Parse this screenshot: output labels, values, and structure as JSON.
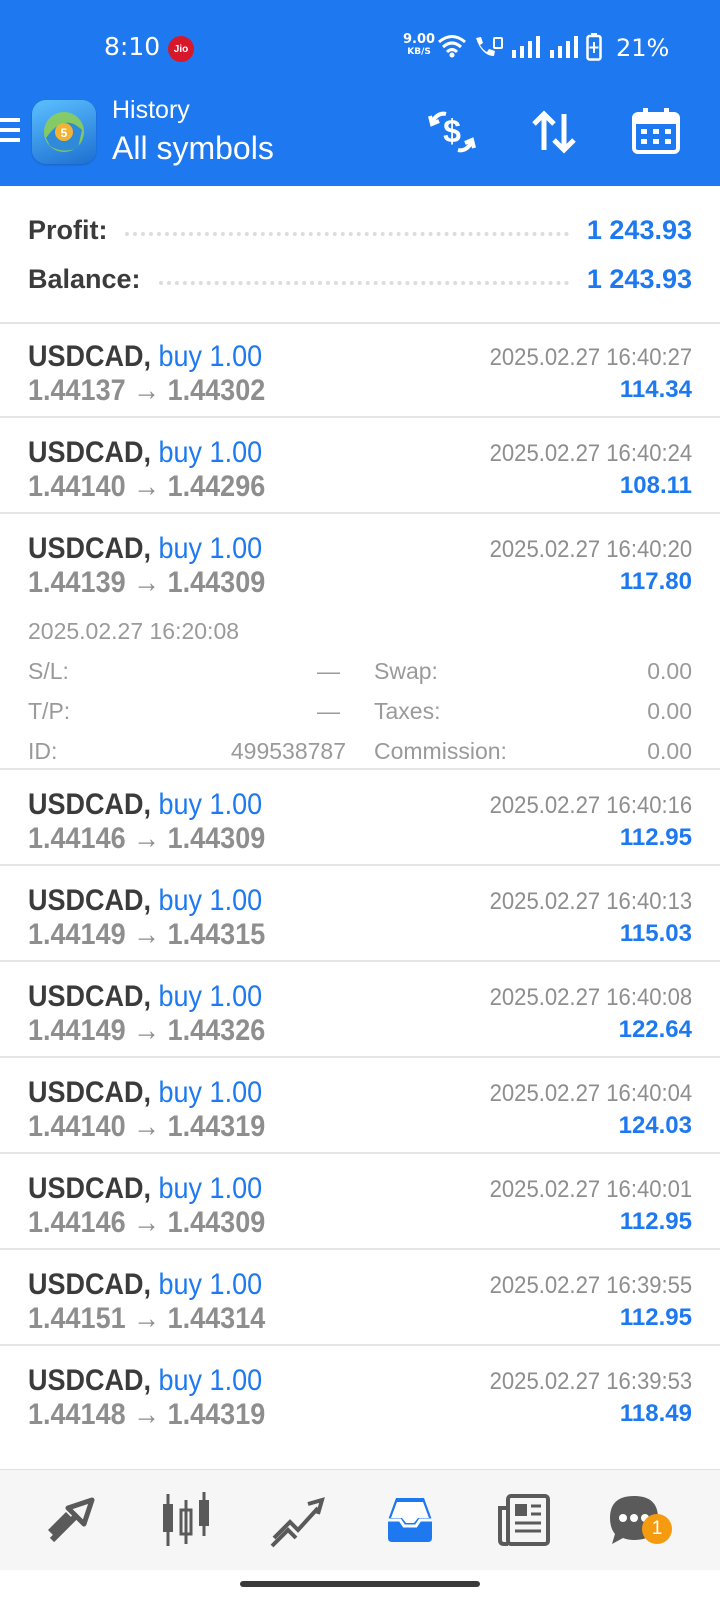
{
  "status_bar": {
    "time": "8:10",
    "carrier_badge": "Jio",
    "net_speed_value": "9.00",
    "net_speed_unit": "KB/S",
    "battery_percent": "21%"
  },
  "app_bar": {
    "title": "History",
    "subtitle": "All symbols",
    "icons": [
      "menu-icon",
      "metatrader-logo",
      "dollar-refresh-icon",
      "sort-icon",
      "calendar-icon"
    ]
  },
  "summary": {
    "profit_label": "Profit:",
    "profit_value": "1 243.93",
    "balance_label": "Balance:",
    "balance_value": "1 243.93"
  },
  "deals": [
    {
      "symbol": "USDCAD,",
      "type": "buy 1.00",
      "price_open": "1.44137",
      "price_close": "1.44302",
      "arrow": "→",
      "time": "2025.02.27 16:40:27",
      "profit": "114.34"
    },
    {
      "symbol": "USDCAD,",
      "type": "buy 1.00",
      "price_open": "1.44140",
      "price_close": "1.44296",
      "arrow": "→",
      "time": "2025.02.27 16:40:24",
      "profit": "108.11"
    },
    {
      "symbol": "USDCAD,",
      "type": "buy 1.00",
      "price_open": "1.44139",
      "price_close": "1.44309",
      "arrow": "→",
      "time": "2025.02.27 16:40:20",
      "profit": "117.80"
    },
    {
      "symbol": "USDCAD,",
      "type": "buy 1.00",
      "price_open": "1.44146",
      "price_close": "1.44309",
      "arrow": "→",
      "time": "2025.02.27 16:40:16",
      "profit": "112.95"
    },
    {
      "symbol": "USDCAD,",
      "type": "buy 1.00",
      "price_open": "1.44149",
      "price_close": "1.44315",
      "arrow": "→",
      "time": "2025.02.27 16:40:13",
      "profit": "115.03"
    },
    {
      "symbol": "USDCAD,",
      "type": "buy 1.00",
      "price_open": "1.44149",
      "price_close": "1.44326",
      "arrow": "→",
      "time": "2025.02.27 16:40:08",
      "profit": "122.64"
    },
    {
      "symbol": "USDCAD,",
      "type": "buy 1.00",
      "price_open": "1.44140",
      "price_close": "1.44319",
      "arrow": "→",
      "time": "2025.02.27 16:40:04",
      "profit": "124.03"
    },
    {
      "symbol": "USDCAD,",
      "type": "buy 1.00",
      "price_open": "1.44146",
      "price_close": "1.44309",
      "arrow": "→",
      "time": "2025.02.27 16:40:01",
      "profit": "112.95"
    },
    {
      "symbol": "USDCAD,",
      "type": "buy 1.00",
      "price_open": "1.44151",
      "price_close": "1.44314",
      "arrow": "→",
      "time": "2025.02.27 16:39:55",
      "profit": "112.95"
    },
    {
      "symbol": "USDCAD,",
      "type": "buy 1.00",
      "price_open": "1.44148",
      "price_close": "1.44319",
      "arrow": "→",
      "time": "2025.02.27 16:39:53",
      "profit": "118.49"
    }
  ],
  "expanded_details": {
    "open_time": "2025.02.27 16:20:08",
    "sl_label": "S/L:",
    "sl_value": "—",
    "tp_label": "T/P:",
    "tp_value": "—",
    "id_label": "ID:",
    "id_value": "499538787",
    "swap_label": "Swap:",
    "swap_value": "0.00",
    "taxes_label": "Taxes:",
    "taxes_value": "0.00",
    "commission_label": "Commission:",
    "commission_value": "0.00"
  },
  "bottom_nav": {
    "items": [
      "quotes-icon",
      "chart-icon",
      "trade-icon",
      "history-icon",
      "news-icon",
      "messages-icon"
    ],
    "active": "history-icon",
    "messages_badge": "1",
    "active_color": "#1e79f0",
    "inactive_color": "#5a5a5a"
  },
  "colors": {
    "accent": "#1e79f0",
    "badge": "#f59b12"
  }
}
